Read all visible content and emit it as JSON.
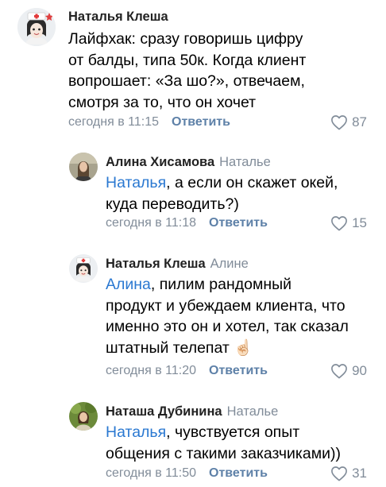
{
  "comments": [
    {
      "author": "Наталья Клеша",
      "reply_to": "",
      "lines": [
        "Лайфхак: сразу говоришь цифру",
        "от балды, типа 50к. Когда клиент",
        "вопрошает: «За шо?», отвечаем,",
        "смотря за то, что он хочет"
      ],
      "mention": "",
      "time": "сегодня в 11:15",
      "reply_label": "Ответить",
      "likes": "87"
    },
    {
      "author": "Алина Хисамова",
      "reply_to": "Наталье",
      "mention": "Наталья",
      "lines": [
        ", а если он скажет окей,",
        "куда переводить?)"
      ],
      "time": "сегодня в 11:18",
      "reply_label": "Ответить",
      "likes": "15"
    },
    {
      "author": "Наталья Клеша",
      "reply_to": "Алине",
      "mention": "Алина",
      "lines": [
        ", пилим рандомный",
        "продукт и убеждаем клиента, что",
        "именно это он и хотел, так сказал",
        "штатный телепат"
      ],
      "emoji": "☝🏻",
      "time": "сегодня в 11:20",
      "reply_label": "Ответить",
      "likes": "90"
    },
    {
      "author": "Наташа Дубинина",
      "reply_to": "Наталье",
      "mention": "Наталья",
      "lines": [
        ", чувствуется опыт",
        "общения с такими заказчиками))"
      ],
      "time": "сегодня в 11:50",
      "reply_label": "Ответить",
      "likes": "31"
    }
  ],
  "colors": {
    "mention": "#2a78d1",
    "reply_button": "#5e81a8",
    "meta": "#818c99"
  }
}
